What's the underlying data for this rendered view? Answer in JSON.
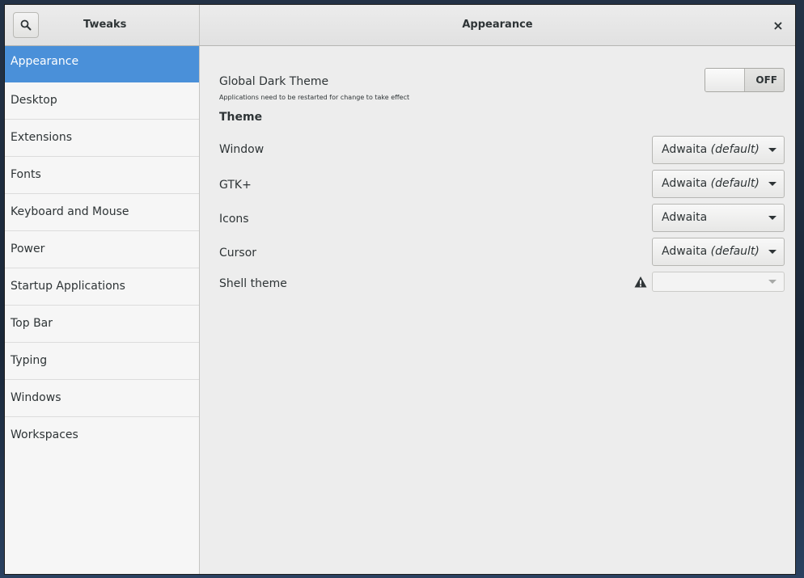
{
  "titlebar": {
    "sidebar_title": "Tweaks",
    "main_title": "Appearance",
    "close_glyph": "×"
  },
  "sidebar": {
    "items": [
      {
        "label": "Appearance",
        "selected": true
      },
      {
        "label": "Desktop",
        "selected": false
      },
      {
        "label": "Extensions",
        "selected": false
      },
      {
        "label": "Fonts",
        "selected": false
      },
      {
        "label": "Keyboard and Mouse",
        "selected": false
      },
      {
        "label": "Power",
        "selected": false
      },
      {
        "label": "Startup Applications",
        "selected": false
      },
      {
        "label": "Top Bar",
        "selected": false
      },
      {
        "label": "Typing",
        "selected": false
      },
      {
        "label": "Windows",
        "selected": false
      },
      {
        "label": "Workspaces",
        "selected": false
      }
    ]
  },
  "main": {
    "global_dark_theme": {
      "label": "Global Dark Theme",
      "description": "Applications need to be restarted for change to take effect",
      "switch_state": "OFF"
    },
    "theme_heading": "Theme",
    "rows": {
      "window": {
        "label": "Window",
        "value": "Adwaita",
        "suffix": "(default)"
      },
      "gtk": {
        "label": "GTK+",
        "value": "Adwaita",
        "suffix": "(default)"
      },
      "icons": {
        "label": "Icons",
        "value": "Adwaita",
        "suffix": ""
      },
      "cursor": {
        "label": "Cursor",
        "value": "Adwaita",
        "suffix": "(default)"
      },
      "shell": {
        "label": "Shell theme",
        "value": "",
        "suffix": "",
        "disabled": true
      }
    }
  },
  "colors": {
    "accent": "#4a90d9",
    "text": "#2e3436",
    "background": "#ededed"
  },
  "icons": {
    "search": "search-icon",
    "close": "close-icon",
    "warning": "warning-icon",
    "dropdown": "chevron-down-icon"
  }
}
